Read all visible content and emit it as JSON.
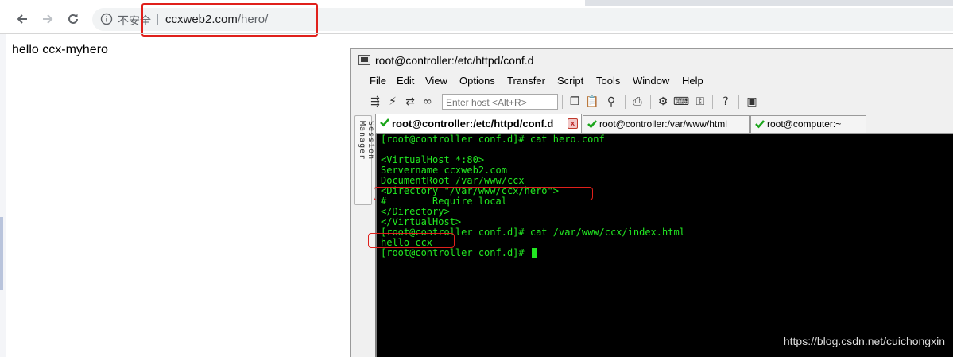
{
  "browser": {
    "security_label": "不安全",
    "url_host": "ccxweb2.com",
    "url_path": "/hero/"
  },
  "page": {
    "body_text": "hello ccx-myhero"
  },
  "crt": {
    "title": "root@controller:/etc/httpd/conf.d",
    "menu": [
      "File",
      "Edit",
      "View",
      "Options",
      "Transfer",
      "Script",
      "Tools",
      "Window",
      "Help"
    ],
    "host_placeholder": "Enter host <Alt+R>",
    "session_manager": "Session Manager",
    "tabs": [
      {
        "label": "root@controller:/etc/httpd/conf.d",
        "active": true
      },
      {
        "label": "root@controller:/var/www/html",
        "active": false
      },
      {
        "label": "root@computer:~",
        "active": false
      }
    ],
    "terminal_lines": [
      "[root@controller conf.d]# cat hero.conf",
      "",
      "<VirtualHost *:80>",
      "Servername ccxweb2.com",
      "DocumentRoot /var/www/ccx",
      "<Directory \"/var/www/ccx/hero\">",
      "#        Require local",
      "</Directory>",
      "</VirtualHost>",
      "[root@controller conf.d]# cat /var/www/ccx/index.html",
      "hello ccx",
      "[root@controller conf.d]# "
    ]
  },
  "watermark": "https://blog.csdn.net/cuichongxin",
  "colors": {
    "terminal_text": "#22e822",
    "terminal_bg": "#000000",
    "annotation": "#e0201b"
  }
}
